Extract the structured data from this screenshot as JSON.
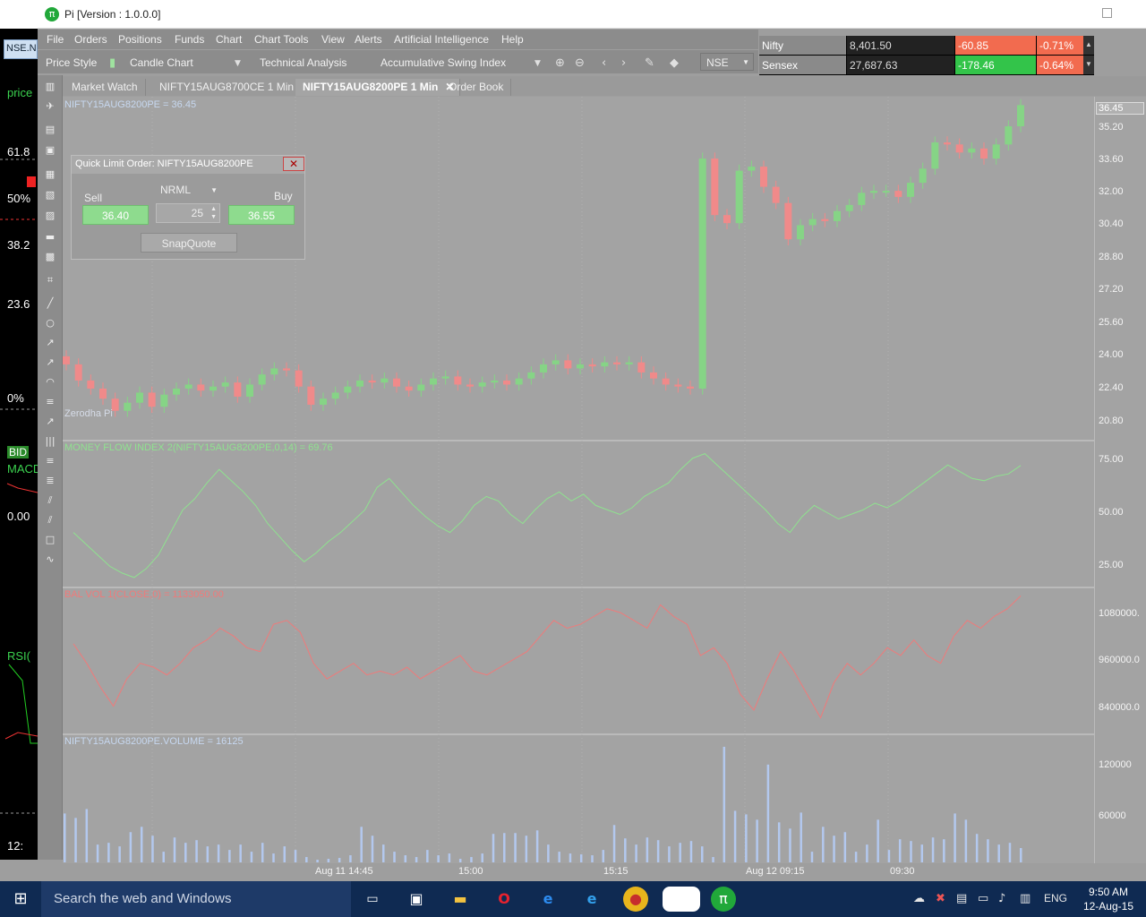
{
  "window": {
    "title": "Pi [Version : 1.0.0.0]",
    "logo": "π"
  },
  "background_app": {
    "tab": "NSE.N",
    "labels": [
      "price",
      "61.8",
      "50%",
      "38.2",
      "23.6",
      "0%",
      "BID",
      "MACD",
      "0.00",
      "RSI(",
      "12:"
    ]
  },
  "menu": {
    "items": [
      "File",
      "Orders",
      "Positions",
      "Funds",
      "Chart",
      "Chart Tools",
      "View",
      "Alerts",
      "Artificial Intelligence",
      "Help"
    ]
  },
  "toolbar": {
    "price_style_label": "Price Style",
    "price_style_value": "Candle Chart",
    "technical_analysis_label": "Technical Analysis",
    "indicator_value": "Accumulative Swing Index",
    "exchange": "NSE"
  },
  "ticker": [
    {
      "name": "Nifty",
      "value": "8,401.50",
      "change": "-60.85",
      "pct": "-0.71%",
      "color": "#f26b4f"
    },
    {
      "name": "Sensex",
      "value": "27,687.63",
      "change": "-178.46",
      "pct": "-0.64%",
      "color": "#33c44a"
    }
  ],
  "tabs": [
    "Market Watch",
    "NIFTY15AUG8700CE 1 Min",
    "NIFTY15AUG8200PE 1 Min",
    "Order Book"
  ],
  "active_tab": "NIFTY15AUG8200PE 1 Min",
  "panels": {
    "price": {
      "label": "NIFTY15AUG8200PE = 36.45",
      "last": "36.45",
      "ticks": [
        "35.20",
        "33.60",
        "32.00",
        "30.40",
        "28.80",
        "27.20",
        "25.60",
        "24.00",
        "22.40",
        "20.80"
      ]
    },
    "mfi": {
      "label": "MONEY FLOW INDEX 2(NIFTY15AUG8200PE,0,14) = 69.76",
      "ticks": [
        "75.00",
        "50.00",
        "25.00"
      ]
    },
    "balvol": {
      "label": "BAL VOL 1(CLOSE,0) = 1133050.00",
      "ticks": [
        "1080000.",
        "960000.0",
        "840000.0"
      ]
    },
    "volume": {
      "label": "NIFTY15AUG8200PE.VOLUME = 16125",
      "ticks": [
        "120000",
        "60000"
      ]
    }
  },
  "watermark": "Zerodha Pi",
  "x_labels": [
    "Aug 11 14:45",
    "15:00",
    "15:15",
    "Aug 12 09:15",
    "09:30"
  ],
  "quick_order": {
    "title": "Quick Limit Order:  NIFTY15AUG8200PE",
    "product": "NRML",
    "sell_label": "Sell",
    "buy_label": "Buy",
    "sell_price": "36.40",
    "buy_price": "36.55",
    "quantity": "25",
    "snapquote": "SnapQuote"
  },
  "taskbar": {
    "search_placeholder": "Search the web and Windows",
    "language": "ENG",
    "time": "9:50 AM",
    "date": "12-Aug-15"
  },
  "colors": {
    "up": "#86d486",
    "down": "#f08a8a",
    "mfi_line": "#8fe28f",
    "balvol_line": "#f07a7a",
    "volume_bar": "#b3c8ee",
    "label_blue": "#c7d8f0"
  },
  "chart_data": {
    "type": "line",
    "series": [
      {
        "name": "NIFTY15AUG8200PE",
        "values": [
          23.6,
          22.8,
          22.4,
          21.9,
          21.3,
          21.7,
          22.2,
          21.5,
          22.1,
          22.4,
          22.6,
          22.3,
          22.5,
          22.7,
          22.0,
          22.6,
          23.1,
          23.4,
          23.3,
          22.5,
          21.6,
          21.9,
          22.2,
          22.5,
          22.8,
          22.7,
          22.9,
          22.5,
          22.3,
          22.6,
          22.9,
          23.0,
          22.6,
          22.5,
          22.7,
          22.8,
          22.6,
          22.9,
          23.2,
          23.6,
          23.8,
          23.4,
          23.6,
          23.5,
          23.7,
          23.6,
          23.7,
          23.2,
          22.9,
          22.6,
          22.5,
          22.4,
          33.8,
          31.0,
          30.6,
          33.2,
          33.4,
          32.4,
          31.6,
          29.8,
          30.5,
          30.8,
          30.7,
          31.2,
          31.5,
          32.1,
          32.2,
          32.2,
          31.9,
          32.6,
          33.3,
          34.6,
          34.5,
          34.1,
          34.3,
          33.8,
          34.5,
          35.4,
          36.45
        ]
      },
      {
        "name": "MONEY FLOW INDEX 2(NIFTY15AUG8200PE,0,14)",
        "values": [
          40,
          35,
          30,
          25,
          22,
          20,
          24,
          30,
          40,
          50,
          55,
          62,
          68,
          63,
          58,
          52,
          44,
          38,
          32,
          27,
          31,
          36,
          40,
          45,
          50,
          60,
          64,
          58,
          52,
          47,
          43,
          40,
          45,
          52,
          56,
          54,
          48,
          44,
          50,
          55,
          58,
          54,
          57,
          52,
          50,
          48,
          51,
          56,
          59,
          62,
          68,
          73,
          75,
          70,
          65,
          60,
          55,
          50,
          44,
          40,
          47,
          52,
          49,
          46,
          48,
          50,
          53,
          51,
          54,
          58,
          62,
          66,
          70,
          67,
          64,
          63,
          65,
          66,
          69.76
        ]
      },
      {
        "name": "BAL VOL 1(CLOSE,0)",
        "values": [
          1010000,
          960000,
          900000,
          850000,
          920000,
          960000,
          950000,
          930000,
          960000,
          1000000,
          1020000,
          1050000,
          1030000,
          1000000,
          990000,
          1060000,
          1070000,
          1040000,
          960000,
          920000,
          940000,
          960000,
          930000,
          940000,
          930000,
          950000,
          920000,
          940000,
          960000,
          980000,
          940000,
          930000,
          950000,
          970000,
          990000,
          1030000,
          1070000,
          1050000,
          1060000,
          1080000,
          1100000,
          1090000,
          1070000,
          1050000,
          1110000,
          1080000,
          1060000,
          980000,
          1000000,
          960000,
          880000,
          840000,
          920000,
          990000,
          940000,
          880000,
          820000,
          910000,
          960000,
          930000,
          960000,
          1000000,
          980000,
          1020000,
          980000,
          960000,
          1030000,
          1070000,
          1050000,
          1080000,
          1100000,
          1133050
        ]
      },
      {
        "name": "NIFTY15AUG8200PE.VOLUME",
        "values": [
          55000,
          50000,
          60000,
          20000,
          22000,
          18000,
          34000,
          40000,
          30000,
          12000,
          28000,
          22000,
          25000,
          18000,
          20000,
          14000,
          20000,
          12000,
          22000,
          10000,
          18000,
          14000,
          6000,
          3000,
          4000,
          5000,
          8000,
          40000,
          30000,
          20000,
          12000,
          8000,
          6000,
          14000,
          8000,
          10000,
          4000,
          6000,
          10000,
          32000,
          33000,
          33000,
          30000,
          36000,
          20000,
          12000,
          10000,
          9000,
          8000,
          14000,
          42000,
          27000,
          20000,
          28000,
          25000,
          18000,
          22000,
          24000,
          18000,
          6000,
          130000,
          58000,
          54000,
          48000,
          110000,
          45000,
          38000,
          56000,
          12000,
          40000,
          30000,
          34000,
          12000,
          20000,
          48000,
          14000,
          26000,
          24000,
          20000,
          28000,
          26000,
          55000,
          48000,
          32000,
          26000,
          20000,
          22000,
          16125
        ]
      }
    ],
    "x_tick_labels": [
      "Aug 11 14:45",
      "15:00",
      "15:15",
      "Aug 12 09:15",
      "09:30"
    ],
    "ylim_price": [
      20.0,
      36.6
    ],
    "ylim_mfi": [
      16,
      80
    ],
    "ylim_balvol": [
      780000,
      1150000
    ],
    "ylim_volume": [
      0,
      140000
    ],
    "grid": true
  }
}
